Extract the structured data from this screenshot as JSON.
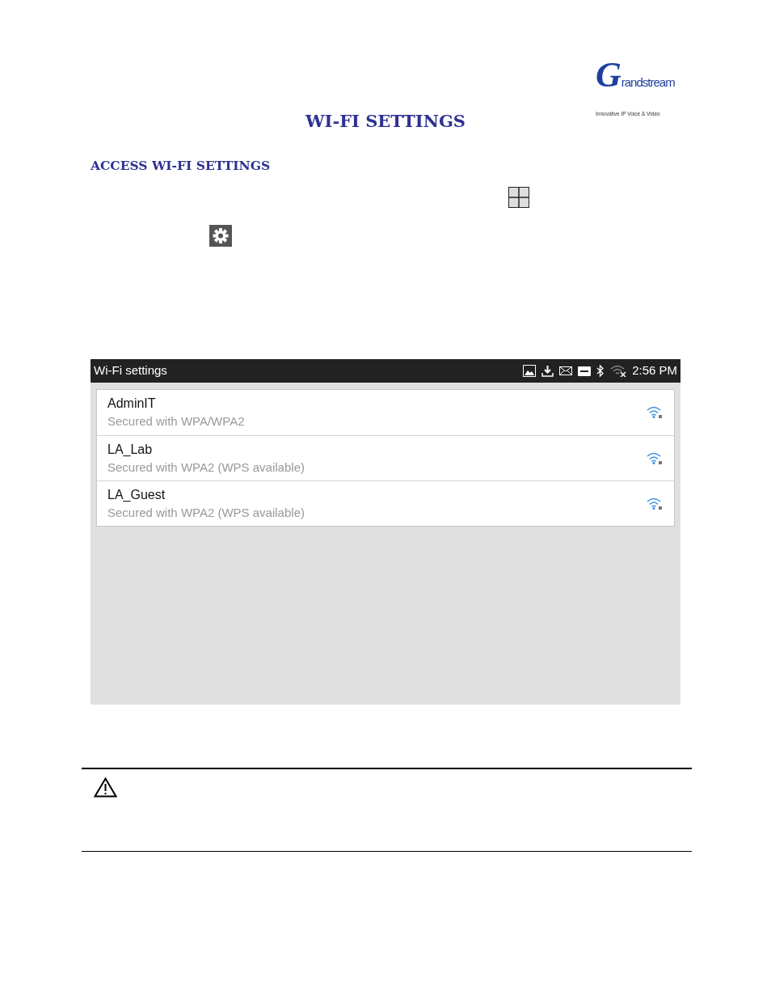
{
  "logo": {
    "name": "Grandstream",
    "tagline": "Innovative IP Voice & Video"
  },
  "title": "WI-FI SETTINGS",
  "section_heading": "ACCESS WI-FI SETTINGS",
  "screen": {
    "title": "Wi-Fi settings",
    "time": "2:56 PM",
    "networks": [
      {
        "name": "AdminIT",
        "security": "Secured with WPA/WPA2"
      },
      {
        "name": "LA_Lab",
        "security": "Secured with WPA2 (WPS available)"
      },
      {
        "name": "LA_Guest",
        "security": "Secured with WPA2 (WPS available)"
      }
    ]
  }
}
